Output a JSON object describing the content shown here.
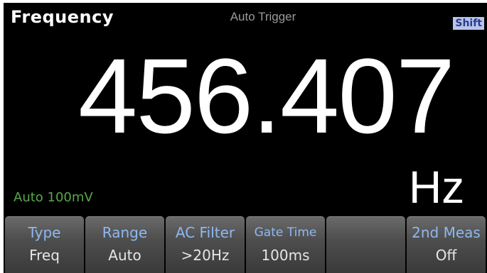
{
  "header": {
    "function_title": "Frequency",
    "trigger_mode": "Auto Trigger",
    "shift_indicator": "Shift"
  },
  "measurement": {
    "reading": "456.407",
    "unit": "Hz",
    "range_indicator": "Auto 100mV"
  },
  "softkeys": [
    {
      "label": "Type",
      "value": "Freq"
    },
    {
      "label": "Range",
      "value": "Auto"
    },
    {
      "label": "AC Filter",
      "value": ">20Hz"
    },
    {
      "label": "Gate Time",
      "value": "100ms"
    },
    {
      "label": "",
      "value": ""
    },
    {
      "label": "2nd Meas",
      "value": "Off"
    }
  ],
  "colors": {
    "background": "#000000",
    "softkey_label": "#8fb8f0",
    "range_indicator": "#58a84a",
    "shift_badge": "#b8c4ea"
  }
}
